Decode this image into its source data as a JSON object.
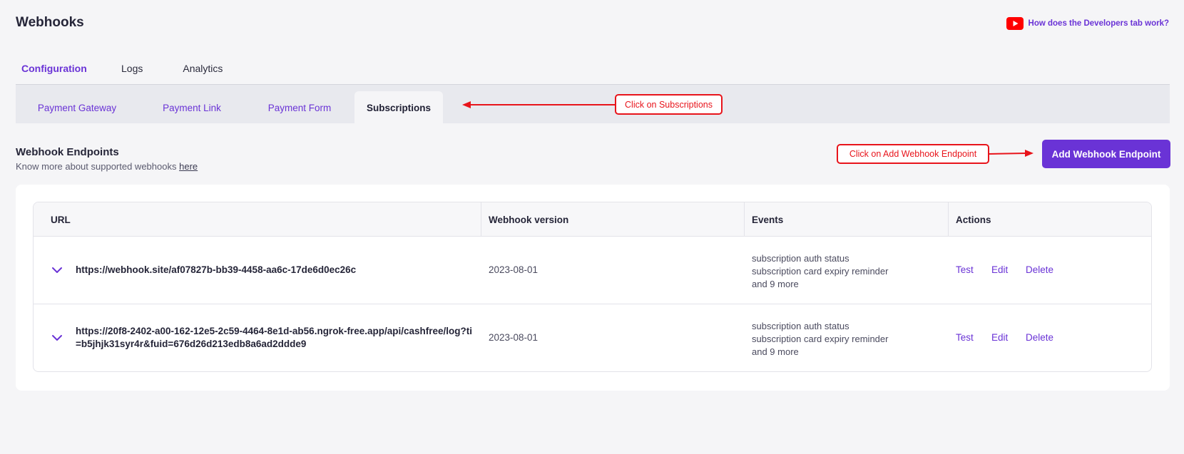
{
  "header": {
    "title": "Webhooks",
    "help_link": "How does the Developers tab work?"
  },
  "main_tabs": [
    {
      "label": "Configuration",
      "active": true
    },
    {
      "label": "Logs",
      "active": false
    },
    {
      "label": "Analytics",
      "active": false
    }
  ],
  "sub_tabs": [
    {
      "label": "Payment Gateway",
      "active": false
    },
    {
      "label": "Payment Link",
      "active": false
    },
    {
      "label": "Payment Form",
      "active": false
    },
    {
      "label": "Subscriptions",
      "active": true
    }
  ],
  "annotations": {
    "subscriptions": "Click on Subscriptions",
    "add_endpoint": "Click on Add Webhook Endpoint"
  },
  "endpoints": {
    "title": "Webhook Endpoints",
    "subtitle": "Know more about supported webhooks",
    "subtitle_link": "here",
    "add_button": "Add Webhook Endpoint",
    "columns": [
      "URL",
      "Webhook version",
      "Events",
      "Actions"
    ],
    "rows": [
      {
        "url": "https://webhook.site/af07827b-bb39-4458-aa6c-17de6d0ec26c",
        "version": "2023-08-01",
        "events": [
          "subscription auth status",
          "subscription card expiry reminder",
          "and 9 more"
        ],
        "actions": [
          "Test",
          "Edit",
          "Delete"
        ]
      },
      {
        "url": "https://20f8-2402-a00-162-12e5-2c59-4464-8e1d-ab56.ngrok-free.app/api/cashfree/log?ti=b5jhjk31syr4r&fuid=676d26d213edb8a6ad2ddde9",
        "version": "2023-08-01",
        "events": [
          "subscription auth status",
          "subscription card expiry reminder",
          "and 9 more"
        ],
        "actions": [
          "Test",
          "Edit",
          "Delete"
        ]
      }
    ]
  },
  "colors": {
    "accent": "#6a33d6",
    "annotation": "#e8141b",
    "youtube": "#ff0000"
  },
  "icons": {
    "help": "youtube-play-icon",
    "row_expand": "chevron-down-icon"
  }
}
